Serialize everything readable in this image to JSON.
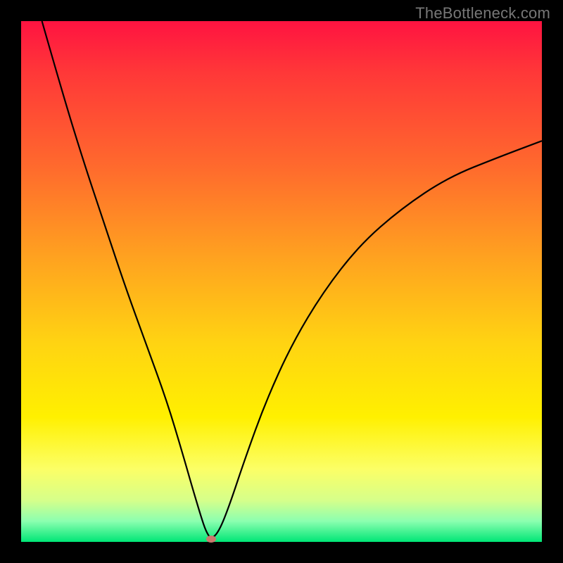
{
  "watermark": "TheBottleneck.com",
  "chart_data": {
    "type": "line",
    "title": "",
    "xlabel": "",
    "ylabel": "",
    "xlim": [
      0,
      100
    ],
    "ylim": [
      0,
      100
    ],
    "grid": false,
    "series": [
      {
        "name": "bottleneck-curve",
        "color": "#000000",
        "x": [
          4,
          8,
          12,
          16,
          20,
          24,
          28,
          31,
          33,
          34.5,
          35.5,
          36.5,
          38,
          40,
          43,
          47,
          52,
          58,
          65,
          73,
          82,
          92,
          100
        ],
        "y": [
          100,
          86,
          73,
          61,
          49,
          38,
          27,
          17,
          10,
          5,
          2,
          0.5,
          2,
          7,
          16,
          27,
          38,
          48,
          57,
          64,
          70,
          74,
          77
        ]
      }
    ],
    "marker": {
      "x": 36.5,
      "y": 0.5,
      "color": "#c97a6e"
    },
    "background_gradient": {
      "top": "#ff1341",
      "mid_upper": "#ffa41f",
      "mid_lower": "#fff000",
      "bottom": "#00e676"
    }
  }
}
